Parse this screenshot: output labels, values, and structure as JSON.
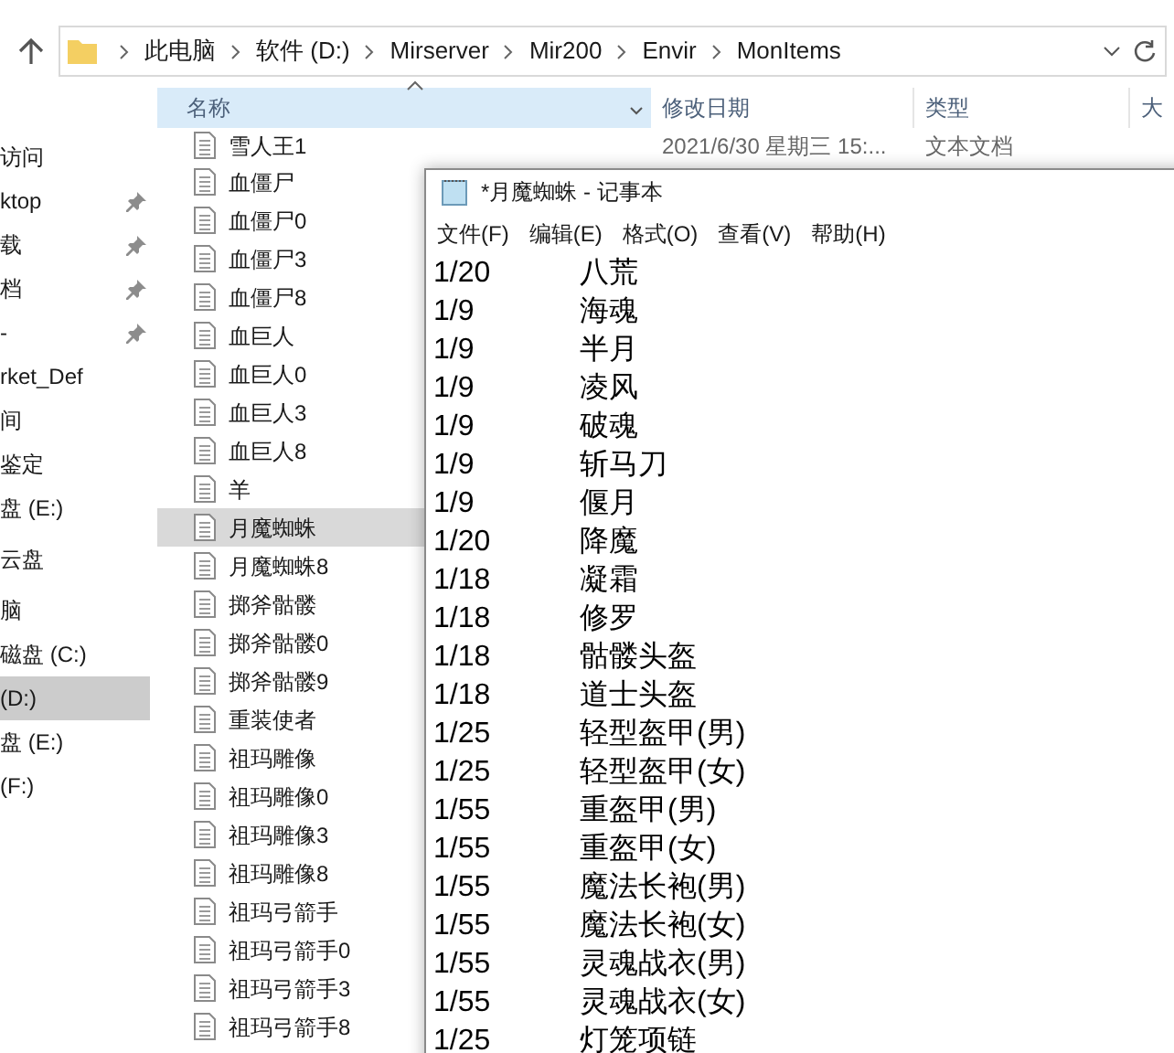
{
  "address_bar": {
    "path": [
      "此电脑",
      "软件 (D:)",
      "Mirserver",
      "Mir200",
      "Envir",
      "MonItems"
    ]
  },
  "sidebar": {
    "items": [
      {
        "label": "访问",
        "pinned": false,
        "selected": false
      },
      {
        "label": "ktop",
        "pinned": true,
        "selected": false
      },
      {
        "label": "载",
        "pinned": true,
        "selected": false
      },
      {
        "label": "档",
        "pinned": true,
        "selected": false
      },
      {
        "label": "-",
        "pinned": true,
        "selected": false
      },
      {
        "label": "rket_Def",
        "pinned": false,
        "selected": false
      },
      {
        "label": "间",
        "pinned": false,
        "selected": false
      },
      {
        "label": "鉴定",
        "pinned": false,
        "selected": false
      },
      {
        "label": "盘 (E:)",
        "pinned": false,
        "selected": false
      },
      {
        "label": "云盘",
        "pinned": false,
        "selected": false
      },
      {
        "label": "脑",
        "pinned": false,
        "selected": false
      },
      {
        "label": "磁盘 (C:)",
        "pinned": false,
        "selected": false
      },
      {
        "label": "(D:)",
        "pinned": false,
        "selected": true
      },
      {
        "label": "盘 (E:)",
        "pinned": false,
        "selected": false
      },
      {
        "label": "(F:)",
        "pinned": false,
        "selected": false
      }
    ]
  },
  "file_list": {
    "columns": [
      "名称",
      "修改日期",
      "类型",
      "大"
    ],
    "first_row": {
      "name": "雪人王1",
      "date": "2021/6/30 星期三 15:...",
      "type": "文本文档"
    },
    "rows": [
      {
        "name": "血僵尸",
        "selected": false
      },
      {
        "name": "血僵尸0",
        "selected": false
      },
      {
        "name": "血僵尸3",
        "selected": false
      },
      {
        "name": "血僵尸8",
        "selected": false
      },
      {
        "name": "血巨人",
        "selected": false
      },
      {
        "name": "血巨人0",
        "selected": false
      },
      {
        "name": "血巨人3",
        "selected": false
      },
      {
        "name": "血巨人8",
        "selected": false
      },
      {
        "name": "羊",
        "selected": false
      },
      {
        "name": "月魔蜘蛛",
        "selected": true
      },
      {
        "name": "月魔蜘蛛8",
        "selected": false
      },
      {
        "name": "掷斧骷髅",
        "selected": false
      },
      {
        "name": "掷斧骷髅0",
        "selected": false
      },
      {
        "name": "掷斧骷髅9",
        "selected": false
      },
      {
        "name": "重装使者",
        "selected": false
      },
      {
        "name": "祖玛雕像",
        "selected": false
      },
      {
        "name": "祖玛雕像0",
        "selected": false
      },
      {
        "name": "祖玛雕像3",
        "selected": false
      },
      {
        "name": "祖玛雕像8",
        "selected": false
      },
      {
        "name": "祖玛弓箭手",
        "selected": false
      },
      {
        "name": "祖玛弓箭手0",
        "selected": false
      },
      {
        "name": "祖玛弓箭手3",
        "selected": false
      },
      {
        "name": "祖玛弓箭手8",
        "selected": false
      }
    ]
  },
  "notepad": {
    "title": "*月魔蜘蛛 - 记事本",
    "menu": [
      "文件(F)",
      "编辑(E)",
      "格式(O)",
      "查看(V)",
      "帮助(H)"
    ],
    "lines": [
      {
        "rate": "1/20",
        "item": "八荒"
      },
      {
        "rate": "1/9",
        "item": "海魂"
      },
      {
        "rate": "1/9",
        "item": "半月"
      },
      {
        "rate": "1/9",
        "item": "凌风"
      },
      {
        "rate": "1/9",
        "item": "破魂"
      },
      {
        "rate": "1/9",
        "item": "斩马刀"
      },
      {
        "rate": "1/9",
        "item": "偃月"
      },
      {
        "rate": "1/20",
        "item": "降魔"
      },
      {
        "rate": "1/18",
        "item": "凝霜"
      },
      {
        "rate": "1/18",
        "item": "修罗"
      },
      {
        "rate": "1/18",
        "item": "骷髅头盔"
      },
      {
        "rate": "1/18",
        "item": "道士头盔"
      },
      {
        "rate": "1/25",
        "item": "轻型盔甲(男)"
      },
      {
        "rate": "1/25",
        "item": "轻型盔甲(女)"
      },
      {
        "rate": "1/55",
        "item": "重盔甲(男)"
      },
      {
        "rate": "1/55",
        "item": "重盔甲(女)"
      },
      {
        "rate": "1/55",
        "item": "魔法长袍(男)"
      },
      {
        "rate": "1/55",
        "item": "魔法长袍(女)"
      },
      {
        "rate": "1/55",
        "item": "灵魂战衣(男)"
      },
      {
        "rate": "1/55",
        "item": "灵魂战衣(女)"
      },
      {
        "rate": "1/25",
        "item": "灯笼项链"
      }
    ]
  }
}
